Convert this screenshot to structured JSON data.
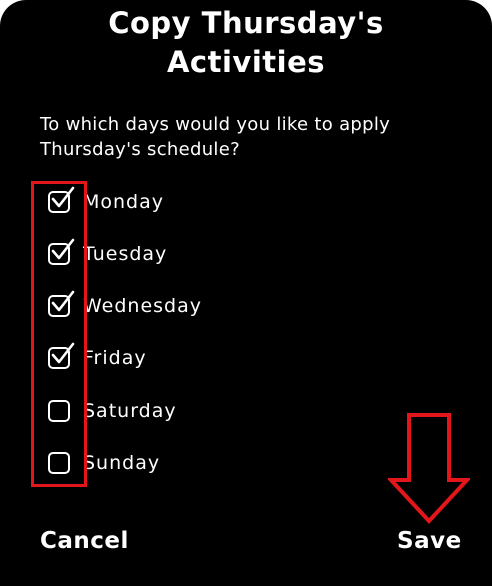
{
  "dialog": {
    "title_line1": "Copy Thursday's",
    "title_line2": "Activities",
    "prompt": "To which days would you like to apply Thursday's schedule?"
  },
  "days": [
    {
      "label": "Monday",
      "checked": true
    },
    {
      "label": "Tuesday",
      "checked": true
    },
    {
      "label": "Wednesday",
      "checked": true
    },
    {
      "label": "Friday",
      "checked": true
    },
    {
      "label": "Saturday",
      "checked": false
    },
    {
      "label": "Sunday",
      "checked": false
    }
  ],
  "actions": {
    "cancel_label": "Cancel",
    "save_label": "Save"
  },
  "colors": {
    "background": "#000000",
    "text": "#ffffff",
    "annotation": "#e3161b"
  },
  "icons": {
    "check": "checkmark-icon",
    "annotation_arrow": "down-arrow-icon"
  }
}
